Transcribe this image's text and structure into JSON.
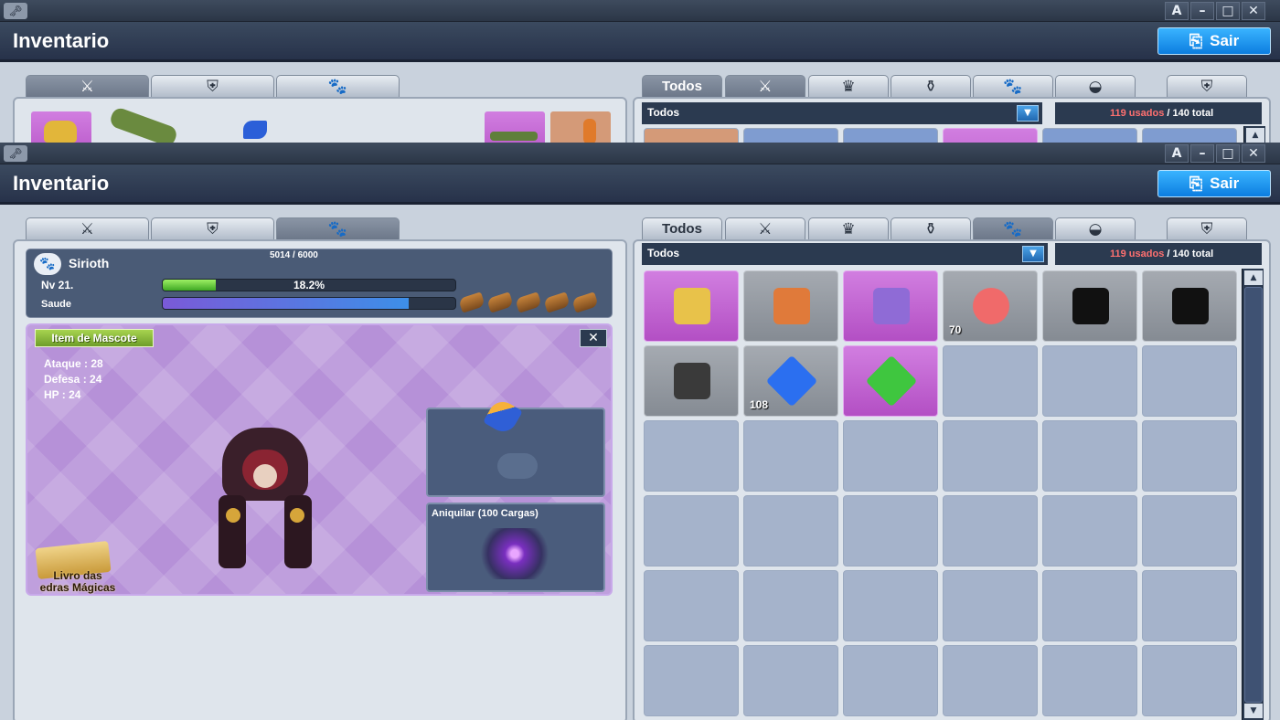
{
  "window_title": "Inventario",
  "exit_label": "Sair",
  "window_buttons": [
    "A",
    "–",
    "□",
    "✕"
  ],
  "left_tabs": [
    {
      "icon": "crossed-swords-icon",
      "glyph": "⚔"
    },
    {
      "icon": "armor-icon",
      "glyph": "⛨"
    },
    {
      "icon": "paw-icon",
      "glyph": "🐾"
    }
  ],
  "right_tabs": [
    {
      "label": "Todos"
    },
    {
      "icon": "crossed-swords-icon",
      "glyph": "⚔"
    },
    {
      "icon": "costume-icon",
      "glyph": "♛"
    },
    {
      "icon": "potion-icon",
      "glyph": "⚱"
    },
    {
      "icon": "paw-icon",
      "glyph": "🐾"
    },
    {
      "icon": "bag-icon",
      "glyph": "◒"
    },
    {
      "icon": "armor-icon",
      "glyph": "⛨"
    }
  ],
  "filter": {
    "selected": "Todos"
  },
  "usage": {
    "used": "119 usados",
    "total": "/ 140 total"
  },
  "pet": {
    "name": "Sirioth",
    "exp_text": "5014 / 6000",
    "level": "Nv 21.",
    "exp_percent_text": "18.2%",
    "exp_fraction": 0.182,
    "health_label": "Saude",
    "health_fraction": 0.84,
    "food_count": 5,
    "item_button": "Item de Mascote",
    "stats": [
      "Ataque : 28",
      "Defesa : 24",
      "HP : 24"
    ],
    "skill_label": "Aniquilar (100 Cargas)",
    "book_label_1": "Livro das",
    "book_label_2": "edras Mágicas"
  },
  "inventory_rows": [
    [
      {
        "style": "purple",
        "icon": "card-icon",
        "color": "#e8c24a",
        "qty": ""
      },
      {
        "style": "gray",
        "icon": "card-icon",
        "color": "#e07a3a",
        "qty": ""
      },
      {
        "style": "purple",
        "icon": "card-icon",
        "color": "#8f6bd6",
        "qty": ""
      },
      {
        "style": "gray",
        "icon": "gem-orb-icon",
        "color": "#f06a6a",
        "qty": "70"
      },
      {
        "style": "gray",
        "icon": "shadow-pet-icon",
        "color": "#111111",
        "qty": ""
      },
      {
        "style": "gray",
        "icon": "shadow-pet-icon",
        "color": "#111111",
        "qty": ""
      }
    ],
    [
      {
        "style": "gray",
        "icon": "statue-icon",
        "color": "#3a3a3a",
        "qty": ""
      },
      {
        "style": "gray",
        "icon": "blue-crystal-icon",
        "color": "#2b6ff0",
        "qty": "108"
      },
      {
        "style": "purple",
        "icon": "green-gem-icon",
        "color": "#3fc63f",
        "qty": ""
      }
    ]
  ],
  "back_inventory_row": [
    {
      "style": "orange"
    },
    {
      "style": "blue"
    },
    {
      "style": "blue"
    },
    {
      "style": "purple"
    },
    {
      "style": "blue"
    },
    {
      "style": "blue"
    }
  ]
}
